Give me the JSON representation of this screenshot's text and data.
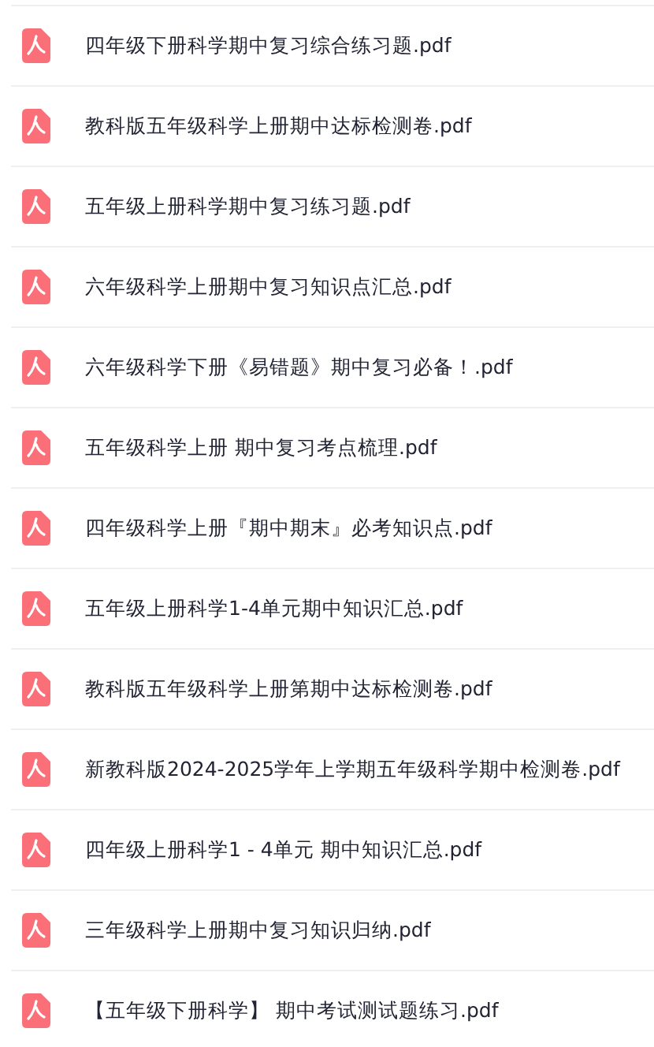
{
  "files": [
    {
      "name": "四年级下册科学期中复习综合练习题.pdf"
    },
    {
      "name": "教科版五年级科学上册期中达标检测卷.pdf"
    },
    {
      "name": "五年级上册科学期中复习练习题.pdf"
    },
    {
      "name": "六年级科学上册期中复习知识点汇总.pdf"
    },
    {
      "name": "六年级科学下册《易错题》期中复习必备！.pdf"
    },
    {
      "name": "五年级科学上册 期中复习考点梳理.pdf"
    },
    {
      "name": "四年级科学上册『期中期末』必考知识点.pdf"
    },
    {
      "name": "五年级上册科学1-4单元期中知识汇总.pdf"
    },
    {
      "name": "教科版五年级科学上册第期中达标检测卷.pdf"
    },
    {
      "name": "新教科版2024-2025学年上学期五年级科学期中检测卷.pdf"
    },
    {
      "name": "四年级上册科学1 - 4单元 期中知识汇总.pdf"
    },
    {
      "name": "三年级科学上册期中复习知识归纳.pdf"
    },
    {
      "name": "【五年级下册科学】 期中考试测试题练习.pdf"
    }
  ]
}
